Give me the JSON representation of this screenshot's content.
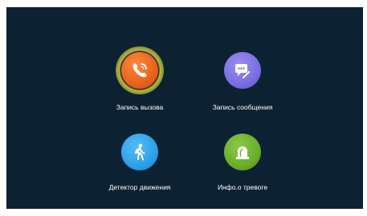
{
  "menu": {
    "items": [
      {
        "label": "Запись вызова",
        "icon": "phone-record-icon",
        "color": "#e8611c",
        "selected": true
      },
      {
        "label": "Запись сообщения",
        "icon": "message-pencil-icon",
        "color": "#7a6ee0",
        "selected": false
      },
      {
        "label": "Детектор движения",
        "icon": "walking-person-icon",
        "color": "#2ea0e8",
        "selected": false
      },
      {
        "label": "Инфо.о тревоге",
        "icon": "alarm-beacon-icon",
        "color": "#6aae2a",
        "selected": false
      }
    ]
  },
  "colors": {
    "background": "#0c2233",
    "selection_ring": "#c8c23c"
  }
}
